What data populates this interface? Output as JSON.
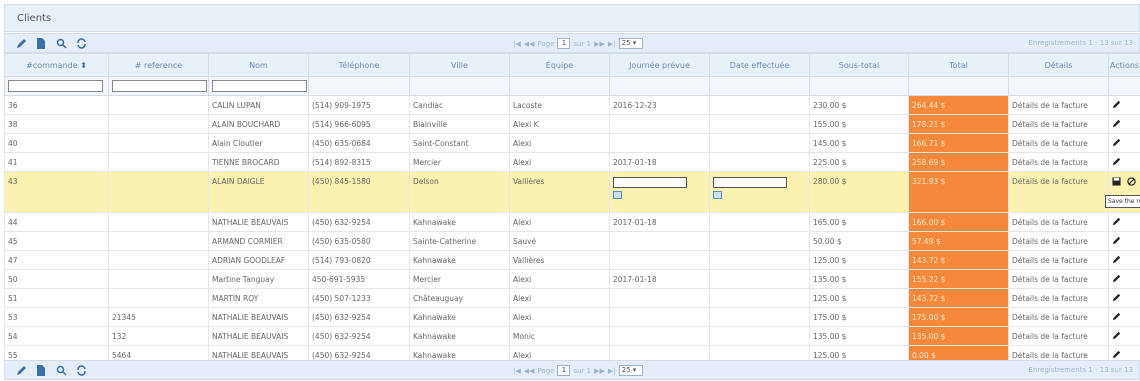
{
  "window": {
    "title": "Clients"
  },
  "pager": {
    "page_label": "Page",
    "page_value": "1",
    "of_label": "sur 1",
    "rows_value": "25 ▾",
    "records": "Enregistrements 1 - 13 sur 13"
  },
  "columns": [
    "#commande",
    "# reference",
    "Nom",
    "Téléphone",
    "Ville",
    "Équipe",
    "Journée prévue",
    "Date effectuée",
    "Sous-total",
    "Total",
    "Détails",
    "Actions"
  ],
  "rows": [
    {
      "cmd": "36",
      "ref": "",
      "nom": "CALIN LUPAN",
      "tel": "(514) 909-1975",
      "ville": "Candiac",
      "equipe": "Lacoste",
      "jour": "2016-12-23",
      "date": "",
      "sous": "230.00 $",
      "total": "264.44 $",
      "details": "Détails de la facture"
    },
    {
      "cmd": "38",
      "ref": "",
      "nom": "ALAIN BOUCHARD",
      "tel": "(514) 966-6095",
      "ville": "Blainville",
      "equipe": "Alexi K",
      "jour": "",
      "date": "",
      "sous": "155.00 $",
      "total": "178.21 $",
      "details": "Détails de la facture"
    },
    {
      "cmd": "40",
      "ref": "",
      "nom": "Alain Cloutier",
      "tel": "(450) 635-0684",
      "ville": "Saint-Constant",
      "equipe": "Alexi",
      "jour": "",
      "date": "",
      "sous": "145.00 $",
      "total": "166.71 $",
      "details": "Détails de la facture"
    },
    {
      "cmd": "41",
      "ref": "",
      "nom": "TIENNE BROCARD",
      "tel": "(514) 892-8315",
      "ville": "Mercier",
      "equipe": "Alexi",
      "jour": "2017-01-18",
      "date": "",
      "sous": "225.00 $",
      "total": "258.69 $",
      "details": "Détails de la facture"
    },
    {
      "cmd": "43",
      "ref": "",
      "nom": "ALAIN DAIGLE",
      "tel": "(450) 845-1580",
      "ville": "Delson",
      "equipe": "Vallières",
      "jour": "",
      "date": "",
      "sous": "280.00 $",
      "total": "321.93 $",
      "details": "Détails de la facture",
      "editing": true
    },
    {
      "cmd": "44",
      "ref": "",
      "nom": "NATHALIE BEAUVAIS",
      "tel": "(450) 632-9254",
      "ville": "Kahnawake",
      "equipe": "Alexi",
      "jour": "2017-01-18",
      "date": "",
      "sous": "165.00 $",
      "total": "166.00 $",
      "details": "Détails de la facture"
    },
    {
      "cmd": "45",
      "ref": "",
      "nom": "ARMAND CORMIER",
      "tel": "(450) 635-0580",
      "ville": "Sainte-Catherine",
      "equipe": "Sauvé",
      "jour": "",
      "date": "",
      "sous": "50.00 $",
      "total": "57.49 $",
      "details": "Détails de la facture"
    },
    {
      "cmd": "47",
      "ref": "",
      "nom": "ADRIAN GOODLEAF",
      "tel": "(514) 793-0820",
      "ville": "Kahnawake",
      "equipe": "Vallières",
      "jour": "",
      "date": "",
      "sous": "125.00 $",
      "total": "143.72 $",
      "details": "Détails de la facture"
    },
    {
      "cmd": "50",
      "ref": "",
      "nom": "Martine Tanguay",
      "tel": "450-691-5935",
      "ville": "Mercier",
      "equipe": "Alexi",
      "jour": "2017-01-18",
      "date": "",
      "sous": "135.00 $",
      "total": "155.22 $",
      "details": "Détails de la facture"
    },
    {
      "cmd": "51",
      "ref": "",
      "nom": "MARTIN ROY",
      "tel": "(450) 507-1233",
      "ville": "Châteauguay",
      "equipe": "Alexi",
      "jour": "",
      "date": "",
      "sous": "125.00 $",
      "total": "143.72 $",
      "details": "Détails de la facture"
    },
    {
      "cmd": "53",
      "ref": "21345",
      "nom": "NATHALIE BEAUVAIS",
      "tel": "(450) 632-9254",
      "ville": "Kahnawake",
      "equipe": "Alexi",
      "jour": "",
      "date": "",
      "sous": "175.00 $",
      "total": "175.00 $",
      "details": "Détails de la facture"
    },
    {
      "cmd": "54",
      "ref": "132",
      "nom": "NATHALIE BEAUVAIS",
      "tel": "(450) 632-9254",
      "ville": "Kahnawake",
      "equipe": "Monic",
      "jour": "",
      "date": "",
      "sous": "135.00 $",
      "total": "135.00 $",
      "details": "Détails de la facture"
    },
    {
      "cmd": "55",
      "ref": "5464",
      "nom": "NATHALIE BEAUVAIS",
      "tel": "(450) 632-9254",
      "ville": "Kahnawake",
      "equipe": "Alexi",
      "jour": "",
      "date": "",
      "sous": "125.00 $",
      "total": "0.00 $",
      "details": "Détails de la facture"
    }
  ],
  "tooltip": "Save the row",
  "colors": {
    "header_bg": "#e8f0f8",
    "header_text": "#6a8db5",
    "total_bg": "#f5883a",
    "edit_row_bg": "#fbf2b2"
  },
  "icons": {
    "edit": "pencil-icon",
    "add": "document-icon",
    "search": "magnifier-icon",
    "refresh": "refresh-icon",
    "save": "floppy-icon",
    "cancel": "cancel-icon"
  }
}
